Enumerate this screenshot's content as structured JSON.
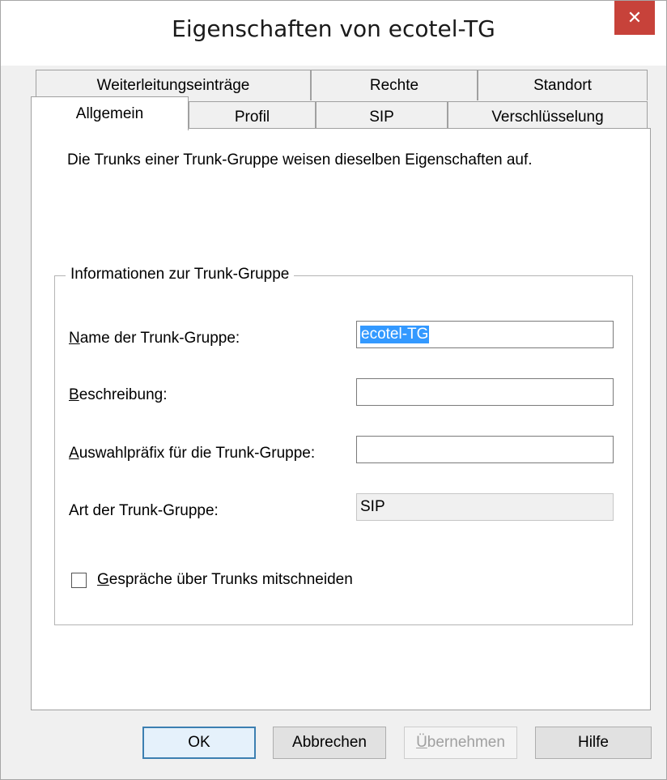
{
  "window": {
    "title": "Eigenschaften von ecotel-TG",
    "close_glyph": "✕"
  },
  "tabs_row1": [
    {
      "label": "Weiterleitungseinträge"
    },
    {
      "label": "Rechte"
    },
    {
      "label": "Standort"
    }
  ],
  "tabs_row2": [
    {
      "label": "Allgemein",
      "active": true
    },
    {
      "label": "Profil"
    },
    {
      "label": "SIP"
    },
    {
      "label": "Verschlüsselung"
    }
  ],
  "intro_text": "Die Trunks einer Trunk-Gruppe weisen dieselben Eigenschaften auf.",
  "group": {
    "legend": "Informationen zur Trunk-Gruppe",
    "name_label_first": "N",
    "name_label_rest": "ame der Trunk-Gruppe:",
    "name_value": "ecotel-TG",
    "desc_label_first": "B",
    "desc_label_rest": "eschreibung:",
    "desc_value": "",
    "prefix_label_first": "A",
    "prefix_label_rest": "uswahlpräfix für die Trunk-Gruppe:",
    "prefix_value": "",
    "type_label": "Art der Trunk-Gruppe:",
    "type_value": "SIP",
    "record_label_first": "G",
    "record_label_rest": "espräche über Trunks mitschneiden",
    "record_checked": false
  },
  "buttons": {
    "ok": "OK",
    "cancel": "Abbrechen",
    "apply_first": "Ü",
    "apply_rest": "bernehmen",
    "help": "Hilfe"
  },
  "colors": {
    "close_bg": "#c7423a",
    "selection": "#3399ff",
    "default_button_border": "#3c7fb1"
  }
}
